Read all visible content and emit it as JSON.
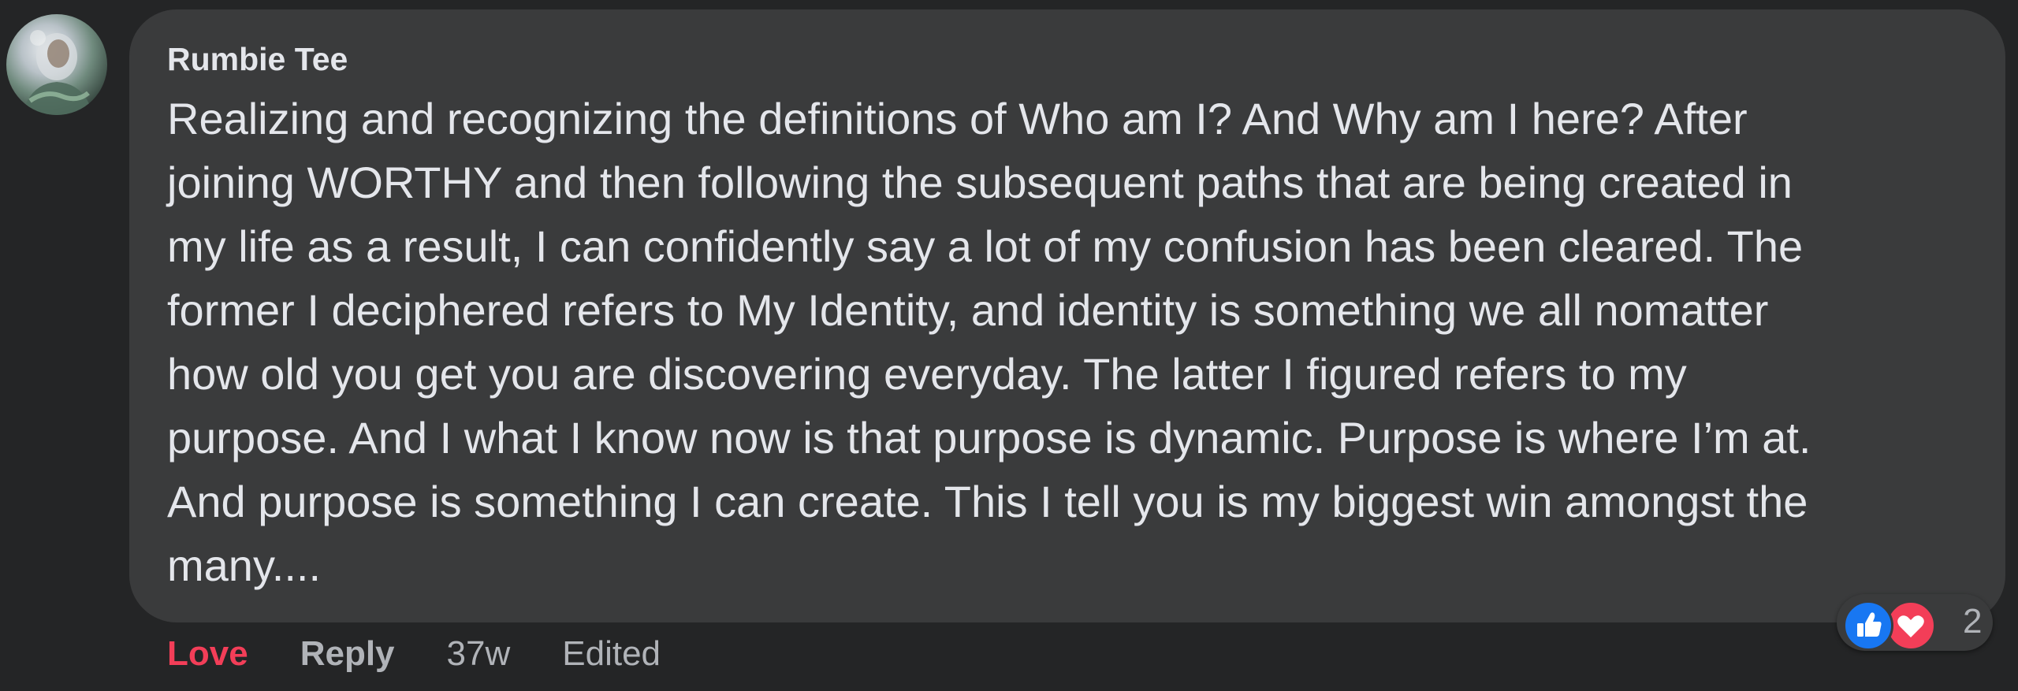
{
  "comment": {
    "author": "Rumbie Tee",
    "text_lines": [
      "Realizing and recognizing the definitions of Who am I? And Why am I here? After",
      "joining WORTHY and then following the subsequent paths that are being created in",
      "my life as a result, I can confidently say a lot of my confusion has been cleared. The",
      "former I deciphered refers to My Identity, and identity is something we all nomatter",
      "how old you get you are discovering everyday. The latter I figured refers to my",
      "purpose. And I what I know now is that purpose is dynamic. Purpose is where I’m at.",
      "And purpose is something I can create. This I tell you is my biggest win amongst the",
      "many...."
    ]
  },
  "actions": {
    "love_label": "Love",
    "reply_label": "Reply",
    "timestamp": "37w",
    "edited_label": "Edited"
  },
  "reactions": {
    "icons": [
      "like-icon",
      "love-icon"
    ],
    "count": "2"
  },
  "colors": {
    "background": "#242526",
    "bubble": "#3a3b3c",
    "text": "#e4e6eb",
    "muted": "#b0b3b8",
    "love": "#f33e58",
    "like": "#1877f2"
  }
}
